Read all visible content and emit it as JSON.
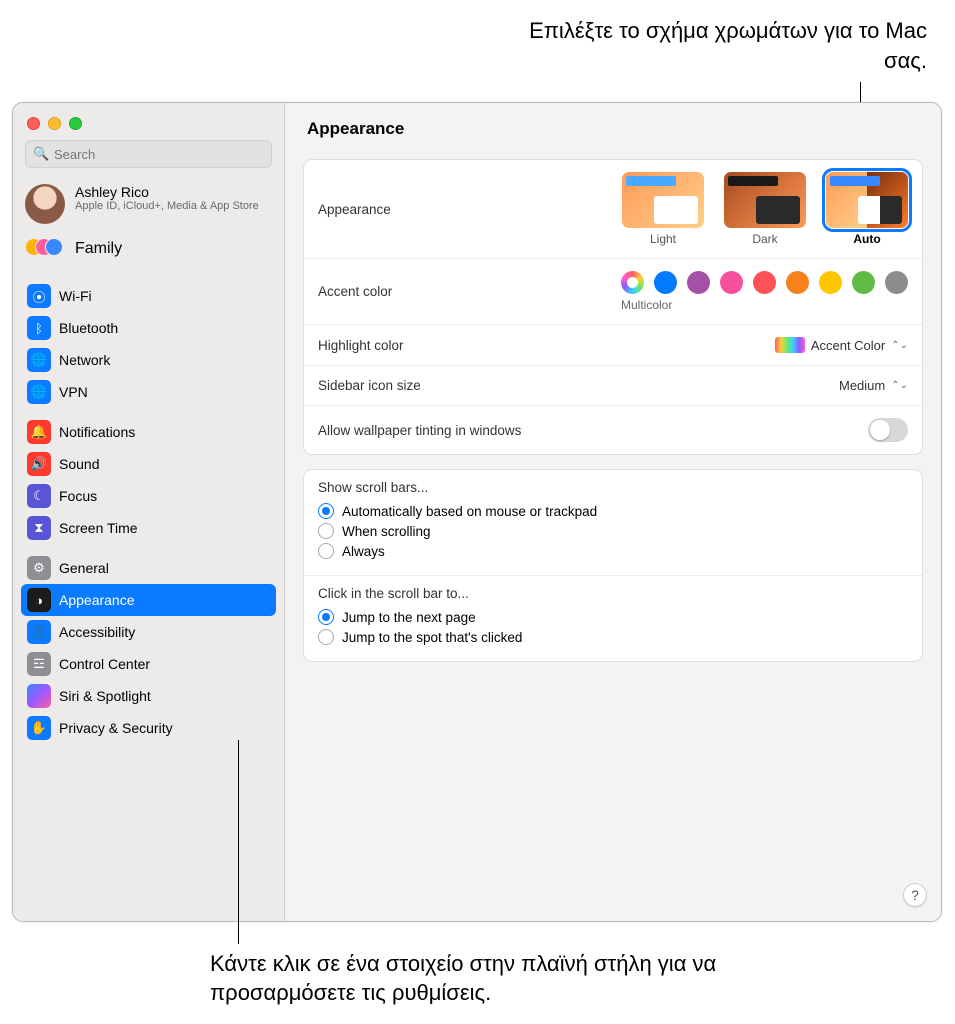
{
  "callouts": {
    "top": "Επιλέξτε το σχήμα χρωμάτων για το Mac σας.",
    "bottom": "Κάντε κλικ σε ένα στοιχείο στην πλαϊνή στήλη για να προσαρμόσετε τις ρυθμίσεις."
  },
  "search": {
    "placeholder": "Search"
  },
  "user": {
    "name": "Ashley Rico",
    "sub": "Apple ID, iCloud+, Media & App Store"
  },
  "family": {
    "label": "Family"
  },
  "sidebar": {
    "g1": [
      {
        "label": "Wi-Fi"
      },
      {
        "label": "Bluetooth"
      },
      {
        "label": "Network"
      },
      {
        "label": "VPN"
      }
    ],
    "g2": [
      {
        "label": "Notifications"
      },
      {
        "label": "Sound"
      },
      {
        "label": "Focus"
      },
      {
        "label": "Screen Time"
      }
    ],
    "g3": [
      {
        "label": "General"
      },
      {
        "label": "Appearance"
      },
      {
        "label": "Accessibility"
      },
      {
        "label": "Control Center"
      },
      {
        "label": "Siri & Spotlight"
      },
      {
        "label": "Privacy & Security"
      }
    ]
  },
  "header": {
    "title": "Appearance"
  },
  "appearance": {
    "label": "Appearance",
    "options": {
      "light": "Light",
      "dark": "Dark",
      "auto": "Auto"
    },
    "selected": "auto"
  },
  "accent": {
    "label": "Accent color",
    "selected_label": "Multicolor",
    "colors": [
      "multicolor",
      "blue",
      "purple",
      "pink",
      "red",
      "orange",
      "yellow",
      "green",
      "gray"
    ]
  },
  "highlight": {
    "label": "Highlight color",
    "value": "Accent Color"
  },
  "sidebar_size": {
    "label": "Sidebar icon size",
    "value": "Medium"
  },
  "tinting": {
    "label": "Allow wallpaper tinting in windows",
    "value": false
  },
  "scrollbars": {
    "title": "Show scroll bars...",
    "opts": {
      "auto": "Automatically based on mouse or trackpad",
      "when": "When scrolling",
      "always": "Always"
    },
    "selected": "auto"
  },
  "scrollclick": {
    "title": "Click in the scroll bar to...",
    "opts": {
      "next": "Jump to the next page",
      "spot": "Jump to the spot that's clicked"
    },
    "selected": "next"
  },
  "help": "?"
}
